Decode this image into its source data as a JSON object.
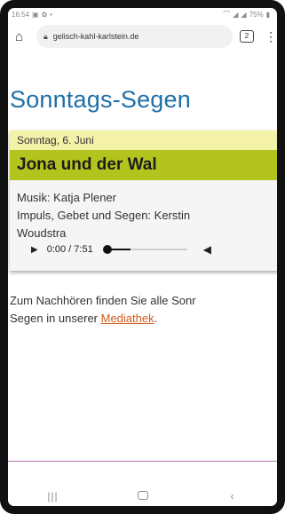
{
  "status_bar": {
    "time": "16:54",
    "battery": "75%"
  },
  "browser": {
    "url": "gelisch-kahl-karlstein.de",
    "tab_count": "2"
  },
  "page": {
    "title": "Sonntags-Segen",
    "date": "Sonntag, 6. Juni",
    "episode_title": "Jona und der Wal",
    "credit_lines": [
      "Musik: Katja Plener",
      "Impuls, Gebet und Segen: Kerstin",
      "Woudstra"
    ],
    "audio": {
      "time": "0:00 / 7:51",
      "progress": 0.0
    },
    "body_prefix": "Zum Nachhören finden Sie alle Sonr",
    "body_second": "Segen in unserer ",
    "body_link": "Mediathek",
    "body_suffix": "."
  },
  "icons": {
    "home": "home-icon",
    "lock": "lock-icon",
    "tabs": "tabs-icon",
    "menu": "overflow-menu-icon",
    "play": "play-icon",
    "volume": "volume-icon",
    "recents": "recents-icon",
    "nav_home": "nav-home-icon",
    "back": "back-icon"
  },
  "colors": {
    "title_blue": "#1f6fa8",
    "date_yellow": "#f4f1a8",
    "title_green": "#b4c41e",
    "link_orange": "#d05a1a"
  }
}
